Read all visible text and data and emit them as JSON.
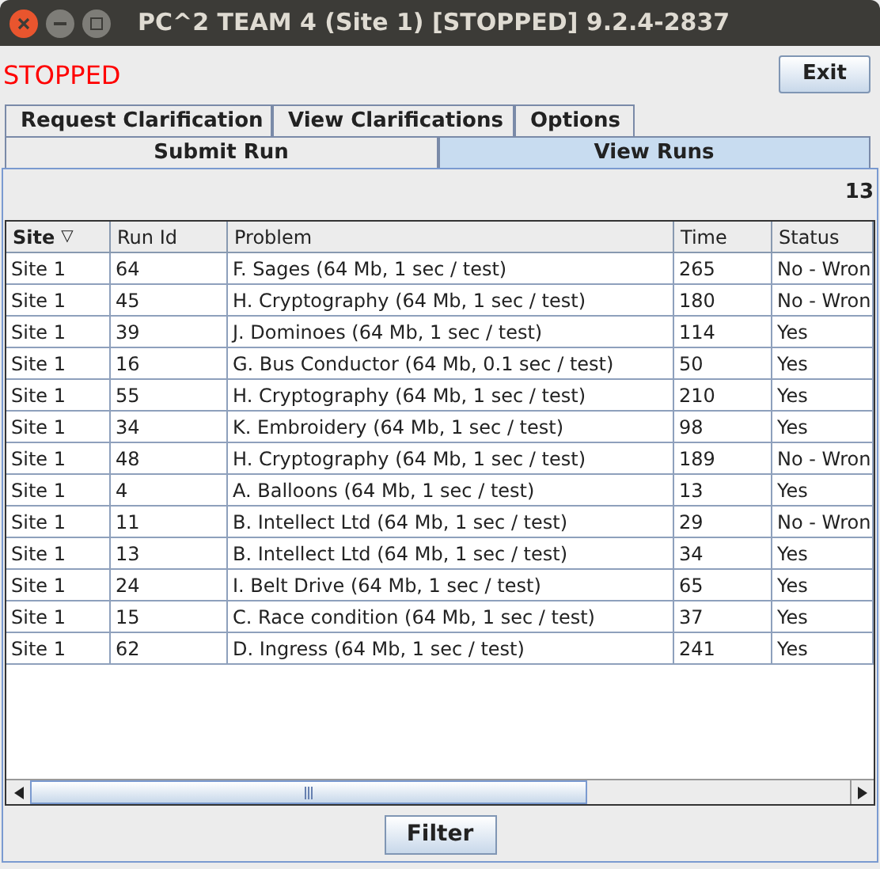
{
  "window": {
    "title": "PC^2 TEAM 4 (Site 1) [STOPPED] 9.2.4-2837"
  },
  "status_label": "STOPPED",
  "exit_button": "Exit",
  "tabs_row_1": [
    {
      "label": "Request Clarification",
      "selected": false
    },
    {
      "label": "View Clarifications",
      "selected": false
    },
    {
      "label": "Options",
      "selected": false
    }
  ],
  "tabs_row_2": [
    {
      "label": "Submit Run",
      "selected": false
    },
    {
      "label": "View Runs",
      "selected": true
    }
  ],
  "run_count": "13",
  "table": {
    "columns": [
      {
        "label": "Site",
        "sort_indicator": "▽"
      },
      {
        "label": "Run Id"
      },
      {
        "label": "Problem"
      },
      {
        "label": "Time"
      },
      {
        "label": "Status"
      }
    ],
    "rows": [
      [
        "Site 1",
        "64",
        "F. Sages (64 Mb, 1 sec / test)",
        "265",
        "No - Wron"
      ],
      [
        "Site 1",
        "45",
        "H. Cryptography (64 Mb, 1 sec / test)",
        "180",
        "No - Wron"
      ],
      [
        "Site 1",
        "39",
        "J. Dominoes (64 Mb, 1 sec / test)",
        "114",
        "Yes"
      ],
      [
        "Site 1",
        "16",
        "G. Bus Conductor (64 Mb, 0.1 sec / test)",
        "50",
        "Yes"
      ],
      [
        "Site 1",
        "55",
        "H. Cryptography (64 Mb, 1 sec / test)",
        "210",
        "Yes"
      ],
      [
        "Site 1",
        "34",
        "K. Embroidery (64 Mb, 1 sec / test)",
        "98",
        "Yes"
      ],
      [
        "Site 1",
        "48",
        "H. Cryptography (64 Mb, 1 sec / test)",
        "189",
        "No - Wron"
      ],
      [
        "Site 1",
        "4",
        "A. Balloons (64 Mb, 1 sec / test)",
        "13",
        "Yes"
      ],
      [
        "Site 1",
        "11",
        "B. Intellect Ltd (64 Mb, 1 sec / test)",
        "29",
        "No - Wron"
      ],
      [
        "Site 1",
        "13",
        "B. Intellect Ltd (64 Mb, 1 sec / test)",
        "34",
        "Yes"
      ],
      [
        "Site 1",
        "24",
        "I. Belt Drive (64 Mb, 1 sec / test)",
        "65",
        "Yes"
      ],
      [
        "Site 1",
        "15",
        "C. Race condition (64 Mb, 1 sec / test)",
        "37",
        "Yes"
      ],
      [
        "Site 1",
        "62",
        "D. Ingress (64 Mb, 1 sec / test)",
        "241",
        "Yes"
      ]
    ]
  },
  "filter_button": "Filter"
}
